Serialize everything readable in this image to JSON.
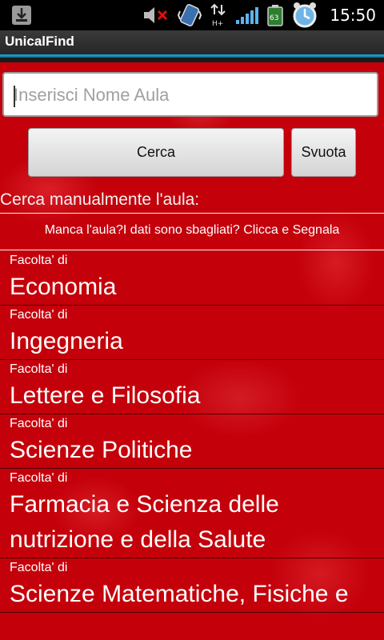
{
  "status_bar": {
    "time": "15:50",
    "battery": "63",
    "icons": [
      "download-icon",
      "muted-volume-icon",
      "phone-vibrate-icon",
      "data-hplus-icon",
      "signal-icon",
      "battery-icon",
      "alarm-icon"
    ]
  },
  "app": {
    "title": "UnicalFind"
  },
  "search": {
    "placeholder": "Inserisci Nome Aula",
    "value": ""
  },
  "buttons": {
    "search": "Cerca",
    "clear": "Svuota"
  },
  "manual": {
    "label": "Cerca manualmente l'aula:"
  },
  "report": {
    "text": "Manca l'aula?I dati sono sbagliati? Clicca e Segnala"
  },
  "faculties": [
    {
      "prefix": "Facolta' di",
      "name": "Economia"
    },
    {
      "prefix": "Facolta' di",
      "name": "Ingegneria"
    },
    {
      "prefix": "Facolta' di",
      "name": "Lettere e Filosofia"
    },
    {
      "prefix": "Facolta' di",
      "name": "Scienze Politiche"
    },
    {
      "prefix": "Facolta' di",
      "name": "Farmacia e Scienza delle nutrizione e della Salute"
    },
    {
      "prefix": "Facolta' di",
      "name": "Scienze Matematiche, Fisiche e"
    }
  ],
  "colors": {
    "background": "#c4000b",
    "accent": "#1fa8d8"
  }
}
